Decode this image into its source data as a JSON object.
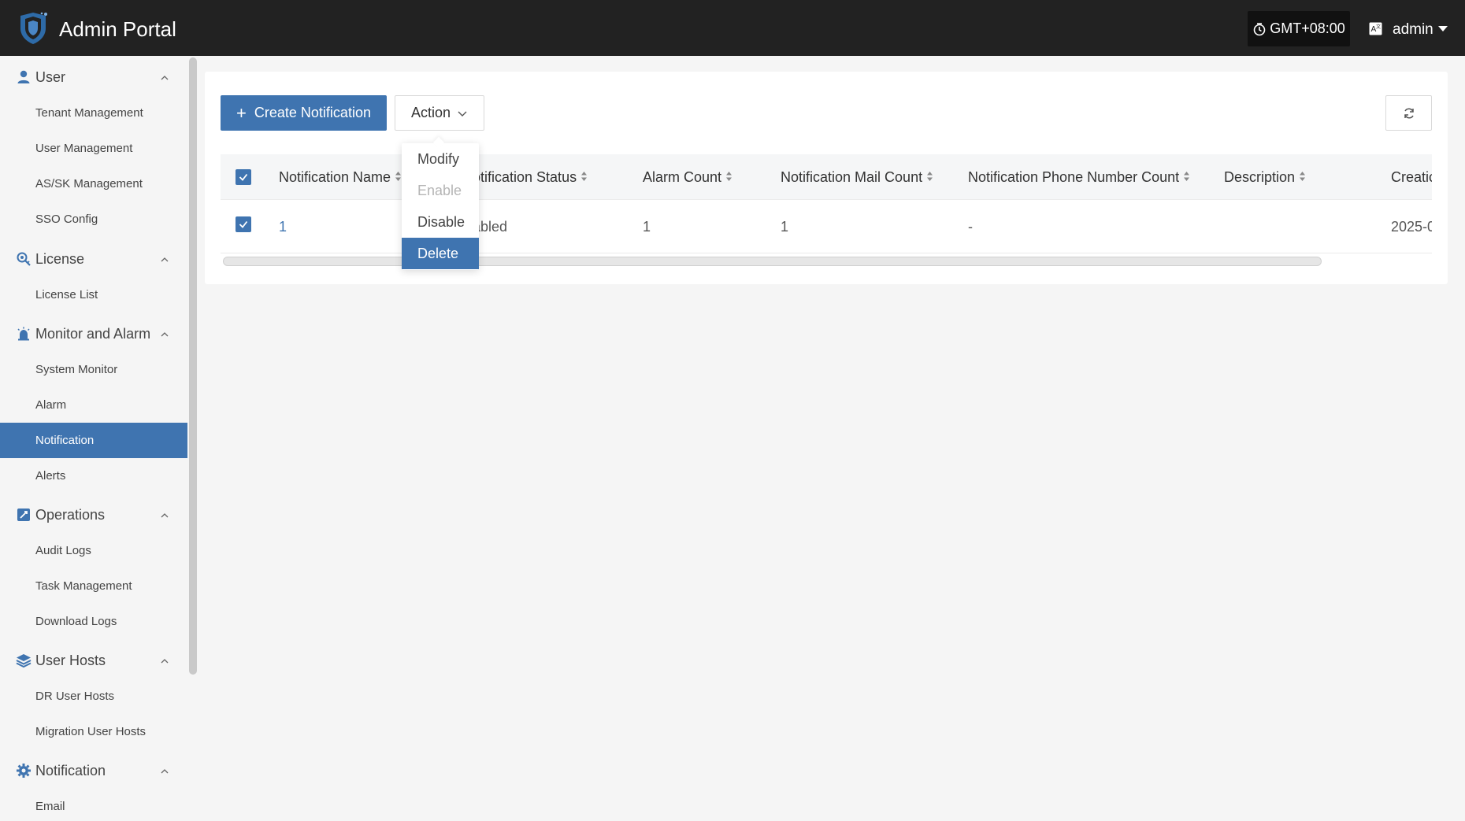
{
  "header": {
    "title": "Admin Portal",
    "timezone": "GMT+08:00",
    "user": "admin"
  },
  "sidebar": {
    "groups": [
      {
        "label": "User",
        "icon": "user-icon",
        "items": [
          "Tenant Management",
          "User Management",
          "AS/SK Management",
          "SSO Config"
        ]
      },
      {
        "label": "License",
        "icon": "license-icon",
        "items": [
          "License List"
        ]
      },
      {
        "label": "Monitor and Alarm",
        "icon": "alarm-icon",
        "items": [
          "System Monitor",
          "Alarm",
          "Notification",
          "Alerts"
        ]
      },
      {
        "label": "Operations",
        "icon": "operations-icon",
        "items": [
          "Audit Logs",
          "Task Management",
          "Download Logs"
        ]
      },
      {
        "label": "User Hosts",
        "icon": "layers-icon",
        "items": [
          "DR User Hosts",
          "Migration User Hosts"
        ]
      },
      {
        "label": "Notification",
        "icon": "gear-icon",
        "items": [
          "Email"
        ]
      }
    ],
    "active_item": "Notification"
  },
  "toolbar": {
    "create_label": "Create Notification",
    "action_label": "Action"
  },
  "action_menu": {
    "items": [
      {
        "label": "Modify",
        "state": "normal"
      },
      {
        "label": "Enable",
        "state": "disabled"
      },
      {
        "label": "Disable",
        "state": "normal"
      },
      {
        "label": "Delete",
        "state": "hover"
      }
    ]
  },
  "table": {
    "columns": [
      "Notification Name",
      "otification Status",
      "Alarm Count",
      "Notification Mail Count",
      "Notification Phone Number Count",
      "Description",
      "Creatic"
    ],
    "rows": [
      {
        "name": "1",
        "status": "abled",
        "alarm_count": "1",
        "mail_count": "1",
        "phone_count": "-",
        "description": "",
        "creation": "2025-0"
      }
    ]
  },
  "colors": {
    "header_bg": "#222222",
    "accent": "#3f74b0"
  }
}
